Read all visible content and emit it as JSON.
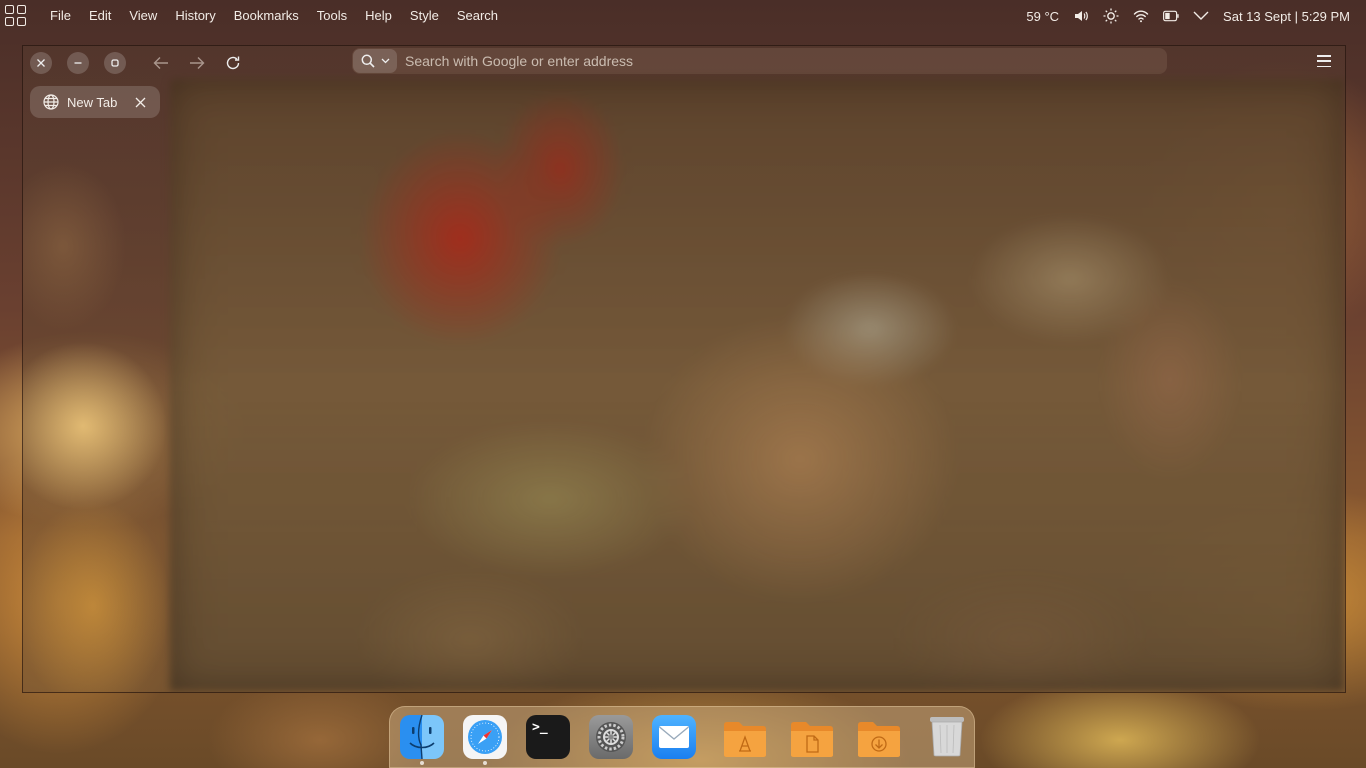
{
  "menubar": {
    "items": [
      "File",
      "Edit",
      "View",
      "History",
      "Bookmarks",
      "Tools",
      "Help",
      "Style",
      "Search"
    ],
    "temperature": "59 °C",
    "datetime": "Sat 13 Sept | 5:29 PM"
  },
  "browser": {
    "address_placeholder": "Search with Google or enter address",
    "tabs": [
      {
        "label": "New Tab"
      }
    ]
  },
  "dock": {
    "apps": [
      "finder",
      "safari",
      "terminal",
      "system-settings",
      "mail",
      "applications-folder",
      "documents-folder",
      "downloads-folder",
      "trash"
    ],
    "running": [
      "finder",
      "safari"
    ]
  }
}
